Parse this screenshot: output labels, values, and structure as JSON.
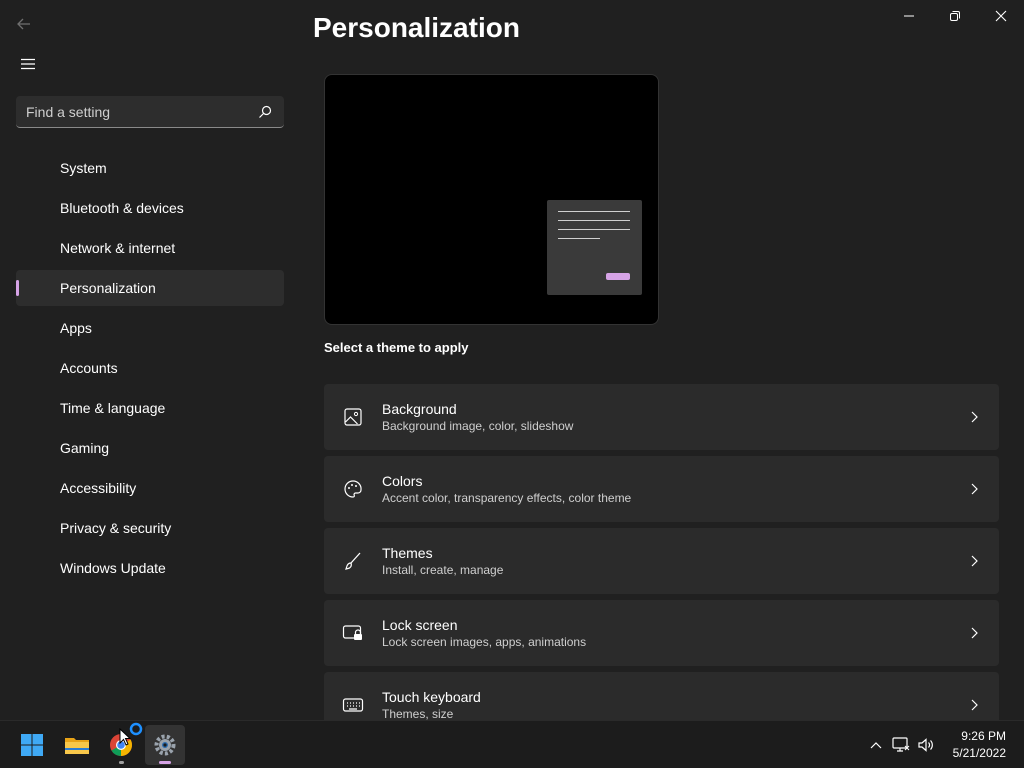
{
  "window": {
    "title": "Personalization",
    "controls": {
      "minimize": "minimize-icon",
      "restore": "restore-icon",
      "close": "close-icon"
    }
  },
  "search": {
    "placeholder": "Find a setting",
    "icon": "search-icon"
  },
  "sidebar": {
    "items": [
      {
        "label": "System"
      },
      {
        "label": "Bluetooth & devices"
      },
      {
        "label": "Network & internet"
      },
      {
        "label": "Personalization",
        "active": true
      },
      {
        "label": "Apps"
      },
      {
        "label": "Accounts"
      },
      {
        "label": "Time & language"
      },
      {
        "label": "Gaming"
      },
      {
        "label": "Accessibility"
      },
      {
        "label": "Privacy & security"
      },
      {
        "label": "Windows Update"
      }
    ]
  },
  "main": {
    "section_label": "Select a theme to apply",
    "cards": [
      {
        "title": "Background",
        "subtitle": "Background image, color, slideshow",
        "icon": "picture-icon"
      },
      {
        "title": "Colors",
        "subtitle": "Accent color, transparency effects, color theme",
        "icon": "palette-icon"
      },
      {
        "title": "Themes",
        "subtitle": "Install, create, manage",
        "icon": "brush-icon"
      },
      {
        "title": "Lock screen",
        "subtitle": "Lock screen images, apps, animations",
        "icon": "lock-screen-icon"
      },
      {
        "title": "Touch keyboard",
        "subtitle": "Themes, size",
        "icon": "keyboard-icon"
      }
    ]
  },
  "taskbar": {
    "apps": [
      "windows-start-icon",
      "file-explorer-icon",
      "chrome-icon",
      "settings-icon"
    ],
    "tray_icons": [
      "chevron-up-icon",
      "network-icon",
      "volume-icon"
    ],
    "time": "9:26 PM",
    "date": "5/21/2022"
  },
  "colors": {
    "accent": "#d6a3e6",
    "background": "#202020",
    "card": "#2b2b2b"
  }
}
